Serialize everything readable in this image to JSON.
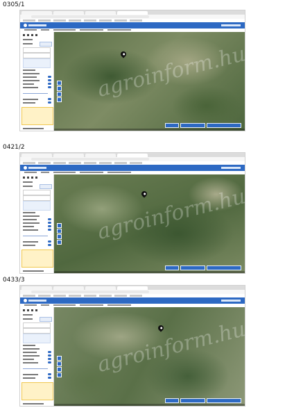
{
  "labels": {
    "first": "0305/1",
    "second": "0421/2",
    "third": "0433/3"
  },
  "watermark": "agroinform.hu",
  "colors": {
    "header_blue": "#2d69c3",
    "warning_box": "#fff2c7"
  },
  "icons": [
    "map-pin-icon",
    "zoom-in-icon",
    "zoom-out-icon",
    "logo-icon"
  ]
}
